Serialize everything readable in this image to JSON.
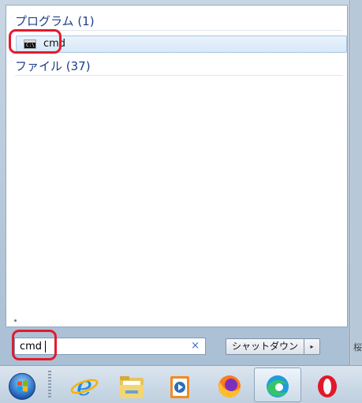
{
  "results": {
    "groups": [
      {
        "label": "プログラム (1)"
      },
      {
        "label": "ファイル (37)"
      }
    ],
    "programs": [
      {
        "label": "cmd",
        "icon": "cmd-icon"
      }
    ]
  },
  "search": {
    "value": "cmd",
    "clear_icon": "×"
  },
  "shutdown": {
    "label": "シャットダウン",
    "arrow": "▸"
  },
  "desktop": {
    "glyph": "桜"
  },
  "taskbar": {
    "items": [
      {
        "name": "start-button",
        "icon": "windows-orb-icon"
      },
      {
        "name": "internet-explorer",
        "icon": "ie-icon"
      },
      {
        "name": "file-explorer",
        "icon": "folder-icon"
      },
      {
        "name": "media-player",
        "icon": "media-player-icon"
      },
      {
        "name": "firefox",
        "icon": "firefox-icon"
      },
      {
        "name": "edge",
        "icon": "edge-icon",
        "active": true
      },
      {
        "name": "opera",
        "icon": "opera-icon"
      }
    ]
  },
  "colors": {
    "annotation": "#e31b2d",
    "group_header": "#1e3d8a",
    "selection": "#d7e8f8"
  }
}
